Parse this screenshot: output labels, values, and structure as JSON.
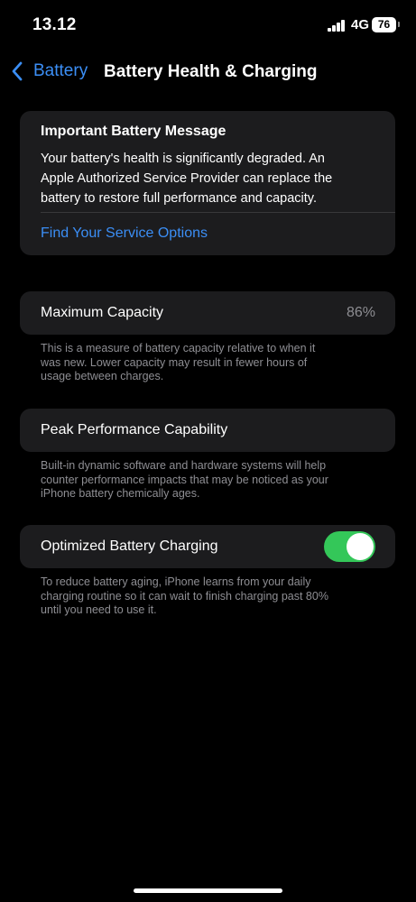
{
  "status_bar": {
    "time": "13.12",
    "network": "4G",
    "battery": "76"
  },
  "nav": {
    "back_label": "Battery",
    "title": "Battery Health & Charging"
  },
  "message": {
    "title": "Important Battery Message",
    "lines": [
      "Your battery's health is significantly degraded. An",
      "Apple Authorized Service Provider can replace the",
      "battery to restore full performance and capacity."
    ],
    "link": "Find Your Service Options"
  },
  "max_capacity": {
    "label": "Maximum Capacity",
    "value": "86%",
    "footnote_lines": [
      "This is a measure of battery capacity relative to when it",
      "was new. Lower capacity may result in fewer hours of",
      "usage between charges."
    ]
  },
  "peak_performance": {
    "label": "Peak Performance Capability",
    "footnote_lines": [
      "Built-in dynamic software and hardware systems will help",
      "counter performance impacts that may be noticed as your",
      "iPhone battery chemically ages."
    ]
  },
  "optimized_charging": {
    "label": "Optimized Battery Charging",
    "enabled": true,
    "footnote_lines": [
      "To reduce battery aging, iPhone learns from your daily",
      "charging routine so it can wait to finish charging past 80%",
      "until you need to use it."
    ]
  },
  "colors": {
    "accent": "#3b8ef5",
    "toggle_on": "#34c759",
    "card": "#1c1c1e",
    "secondary_text": "#8e8e93"
  }
}
